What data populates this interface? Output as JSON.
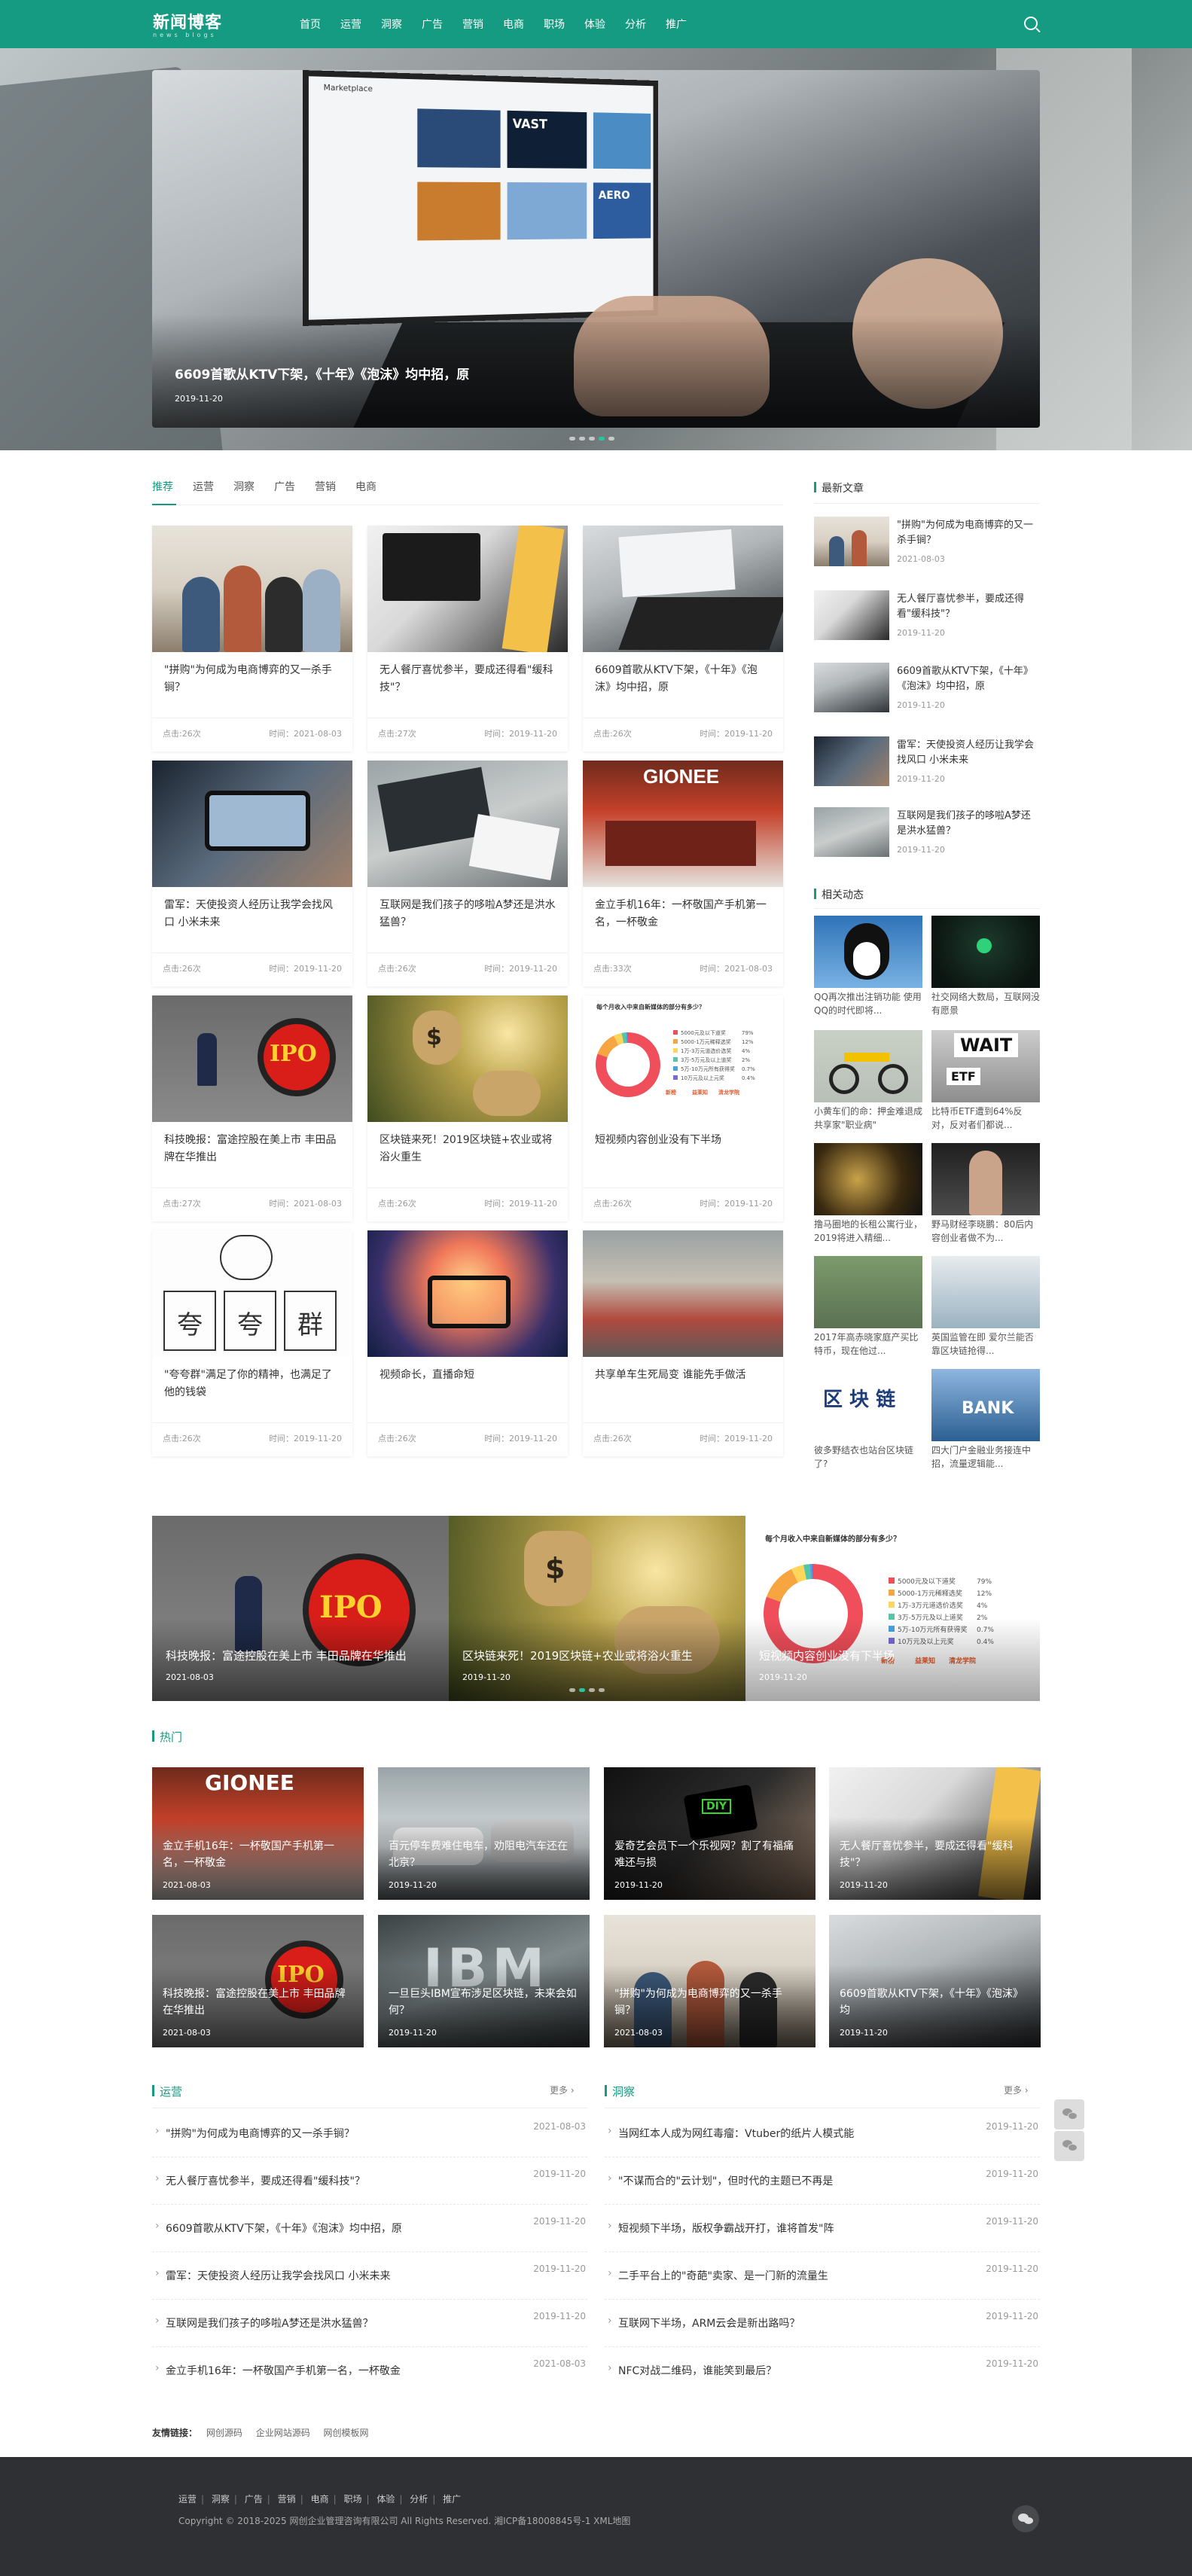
{
  "header": {
    "logo_text": "新闻博客",
    "logo_sub": "news blogs",
    "nav": [
      "首页",
      "运营",
      "洞察",
      "广告",
      "营销",
      "电商",
      "职场",
      "体验",
      "分析",
      "推广"
    ]
  },
  "hero": {
    "title": "6609首歌从KTV下架，《十年》《泡沫》均中招，原",
    "date": "2019-11-20",
    "screen_title": "Marketplace",
    "tile_labels": [
      "VAST",
      "AERO"
    ]
  },
  "tabs": [
    "推荐",
    "运营",
    "洞察",
    "广告",
    "营销",
    "电商"
  ],
  "cards": [
    {
      "title": "\"拼购\"为何成为电商博弈的又一杀手锏？",
      "views": "点击:26次",
      "time": "时间：2021-08-03"
    },
    {
      "title": "无人餐厅喜忧参半，要成还得看\"缓科技\"？",
      "views": "点击:27次",
      "time": "时间：2019-11-20"
    },
    {
      "title": "6609首歌从KTV下架，《十年》《泡沫》均中招，原",
      "views": "点击:26次",
      "time": "时间：2019-11-20"
    },
    {
      "title": "雷军：天使投资人经历让我学会找风口 小米未来",
      "views": "点击:26次",
      "time": "时间：2019-11-20"
    },
    {
      "title": "互联网是我们孩子的哆啦A梦还是洪水猛兽？",
      "views": "点击:26次",
      "time": "时间：2019-11-20"
    },
    {
      "title": "金立手机16年：一杯敬国产手机第一名，一杯敬金",
      "views": "点击:33次",
      "time": "时间：2021-08-03"
    },
    {
      "title": "科技晚报：富途控股在美上市 丰田品牌在华推出",
      "views": "点击:27次",
      "time": "时间：2021-08-03"
    },
    {
      "title": "区块链来死！2019区块链+农业或将浴火重生",
      "views": "点击:26次",
      "time": "时间：2019-11-20"
    },
    {
      "title": "短视频内容创业没有下半场",
      "views": "点击:26次",
      "time": "时间：2019-11-20"
    },
    {
      "title": "\"夸夸群\"满足了你的精神，也满足了他的钱袋",
      "views": "点击:26次",
      "time": "时间：2019-11-20"
    },
    {
      "title": "视频命长，直播命短",
      "views": "点击:26次",
      "time": "时间：2019-11-20"
    },
    {
      "title": "共享单车生死局变 谁能先手做活",
      "views": "点击:26次",
      "time": "时间：2019-11-20"
    }
  ],
  "image_text": {
    "ipo": "IPO",
    "dollar": "$",
    "gionee": "GIONEE",
    "sketch": [
      "夸",
      "夸",
      "群"
    ],
    "ibm": "IBM",
    "diy": "DIY",
    "wait": "WAIT",
    "etf": "ETF",
    "blockchain": "区 块 链",
    "bank": "BANK"
  },
  "donut": {
    "title": "每个月收入中来自新媒体的部分有多少？",
    "legend": [
      {
        "label": "5000元及以下道奖",
        "value": "79%",
        "color": "#f04e5a"
      },
      {
        "label": "5000-1万元稀释选奖",
        "value": "12%",
        "color": "#f7a541"
      },
      {
        "label": "1万-3万元道选价选奖",
        "value": "4%",
        "color": "#ffd55a"
      },
      {
        "label": "3万-5万元及以上道奖",
        "value": "2%",
        "color": "#55c4a7"
      },
      {
        "label": "5万-10万元所有获得奖",
        "value": "0.7%",
        "color": "#4aa3df"
      },
      {
        "label": "10万元及以上元奖",
        "value": "0.4%",
        "color": "#7a6ad8"
      }
    ],
    "brands": [
      "新榜",
      "益莱知",
      "清龙学院"
    ],
    "values": [
      79,
      12,
      4,
      2,
      0.7,
      0.4
    ],
    "colors": [
      "#f04e5a",
      "#f7a541",
      "#ffd55a",
      "#55c4a7",
      "#4aa3df",
      "#7a6ad8"
    ]
  },
  "sidebar": {
    "latest_title": "最新文章",
    "latest": [
      {
        "title": "\"拼购\"为何成为电商博弈的又一杀手锏？",
        "date": "2021-08-03"
      },
      {
        "title": "无人餐厅喜忧参半，要成还得看\"缓科技\"？",
        "date": "2019-11-20"
      },
      {
        "title": "6609首歌从KTV下架，《十年》《泡沫》均中招，原",
        "date": "2019-11-20"
      },
      {
        "title": "雷军：天使投资人经历让我学会找风口 小米未来",
        "date": "2019-11-20"
      },
      {
        "title": "互联网是我们孩子的哆啦A梦还是洪水猛兽？",
        "date": "2019-11-20"
      }
    ],
    "related_title": "相关动态",
    "related": [
      "QQ再次推出注销功能 使用QQ的时代即将...",
      "社交网络大数局，互联网没有愿景",
      "小黄车们的命：押金难退成共享家\"职业病\"",
      "比特币ETF遭到64%反对，反对者们都说...",
      "撸马圈地的长租公寓行业，2019将进入精细...",
      "野马财经李晓鹏：80后内容创业者做不为...",
      "2017年高赤晓家庭产买比特币，现在他过...",
      "英国监管在即 爱尔兰能否靠区块链抢得...",
      "彼多野结衣也站台区块链了?",
      "四大门户金融业务接连中招，流量逻辑能..."
    ]
  },
  "slider": [
    {
      "title": "科技晚报：富途控股在美上市 丰田品牌在华推出",
      "date": "2021-08-03"
    },
    {
      "title": "区块链来死！2019区块链+农业或将浴火重生",
      "date": "2019-11-20"
    },
    {
      "title": "短视频内容创业没有下半场",
      "date": "2019-11-20"
    }
  ],
  "hot": {
    "title": "热门",
    "items": [
      {
        "title": "金立手机16年：一杯敬国产手机第一名，一杯敬金",
        "date": "2021-08-03"
      },
      {
        "title": "百元停车费难住电车，劝阻电汽车还在北京？",
        "date": "2019-11-20"
      },
      {
        "title": "爱奇艺会员下一个乐视网？割了有福痛难还与损",
        "date": "2019-11-20"
      },
      {
        "title": "无人餐厅喜忧参半，要成还得看\"缓科技\"？",
        "date": "2019-11-20"
      },
      {
        "title": "科技晚报：富途控股在美上市 丰田品牌在华推出",
        "date": "2021-08-03"
      },
      {
        "title": "一旦巨头IBM宣布涉足区块链，未来会如何？",
        "date": "2019-11-20"
      },
      {
        "title": "\"拼购\"为何成为电商博弈的又一杀手锏？",
        "date": "2021-08-03"
      },
      {
        "title": "6609首歌从KTV下架，《十年》《泡沫》均",
        "date": "2019-11-20"
      }
    ]
  },
  "list_ops": {
    "title": "运营",
    "more": "更多 ›",
    "items": [
      {
        "title": "\"拼购\"为何成为电商博弈的又一杀手锏？",
        "date": "2021-08-03"
      },
      {
        "title": "无人餐厅喜忧参半，要成还得看\"缓科技\"？",
        "date": "2019-11-20"
      },
      {
        "title": "6609首歌从KTV下架，《十年》《泡沫》均中招，原",
        "date": "2019-11-20"
      },
      {
        "title": "雷军：天使投资人经历让我学会找风口 小米未来",
        "date": "2019-11-20"
      },
      {
        "title": "互联网是我们孩子的哆啦A梦还是洪水猛兽？",
        "date": "2019-11-20"
      },
      {
        "title": "金立手机16年：一杯敬国产手机第一名，一杯敬金",
        "date": "2021-08-03"
      }
    ]
  },
  "list_insight": {
    "title": "洞察",
    "more": "更多 ›",
    "items": [
      {
        "title": "当网红本人成为网红毒瘤：Vtuber的纸片人模式能",
        "date": "2019-11-20"
      },
      {
        "title": "\"不谋而合的\"云计划\"，但时代的主题已不再是",
        "date": "2019-11-20"
      },
      {
        "title": "短视频下半场，版权争霸战开打，谁将首发\"阵",
        "date": "2019-11-20"
      },
      {
        "title": "二手平台上的\"奇葩\"卖家、是一门新的流量生",
        "date": "2019-11-20"
      },
      {
        "title": "互联网下半场，ARM云会是新出路吗？",
        "date": "2019-11-20"
      },
      {
        "title": "NFC对战二维码，谁能笑到最后？",
        "date": "2019-11-20"
      }
    ]
  },
  "friends": {
    "label": "友情链接：",
    "links": [
      "网创源码",
      "企业网站源码",
      "网创模板网"
    ]
  },
  "footer": {
    "nav": [
      "运营",
      "洞察",
      "广告",
      "营销",
      "电商",
      "职场",
      "体验",
      "分析",
      "推广"
    ],
    "copyright": "Copyright © 2018-2025 网创企业管理咨询有限公司 All Rights Reserved. 湘ICP备18008845号-1 XML地图"
  },
  "colors": {
    "brand": "#149b81",
    "footer_bg": "#2e3034"
  }
}
